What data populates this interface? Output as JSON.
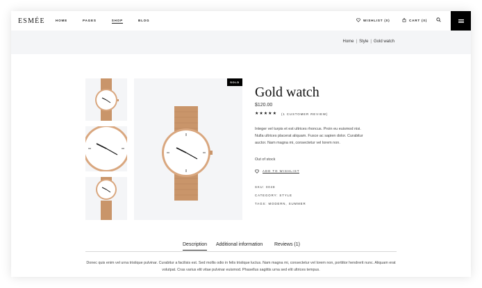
{
  "header": {
    "logo": "ESMÉE",
    "nav": [
      "HOME",
      "PAGES",
      "SHOP",
      "BLOG"
    ],
    "active_nav": "SHOP",
    "wishlist_label": "WISHLIST (0)",
    "cart_label": "CART (0)",
    "icons": {
      "wishlist": "heart-icon",
      "cart": "bag-icon",
      "search": "search-icon",
      "menu": "hamburger-icon"
    }
  },
  "breadcrumb": {
    "items": [
      "Home",
      "Style",
      "Gold watch"
    ],
    "separator": "|"
  },
  "product": {
    "badge": "SOLD",
    "title": "Gold watch",
    "price": "$120.00",
    "rating": 5,
    "rating_max": 5,
    "review_count": "(1 CUSTOMER REVIEW)",
    "description": "Integer vel turpis et est ultrices rhoncus. Proin eu euismod nisi. Nulla ultrices placerat aliquam. Fusce ac sapien dolor. Curabitur auctor. Nam magna mi, consectetur vel lorem non.",
    "stock": "Out of stock",
    "add_to_wishlist": "ADD TO WISHLIST",
    "sku": "SKU: 0048",
    "category": "CATEGORY: STYLE",
    "tags": "TAGS: MODERN, SUMMER"
  },
  "tabs": [
    "Description",
    "Additional information",
    "Reviews (1)"
  ],
  "active_tab": "Description",
  "tab_content": "Donec quis enim vel urna tristique pulvinar. Curabitur a facilisis est. Sed mollis odio in felis tristique luctus. Nam magna mi, consectetur vel lorem non, porttitor hendrerit nunc. Aliquam erat volutpat. Cras varius elit vitae pulvinar euismod. Phasellus sagittis urna sed elit ultrices tempus.",
  "colors": {
    "accent": "#000000",
    "band": "#f4f5f7",
    "gold": "#c9956a"
  }
}
